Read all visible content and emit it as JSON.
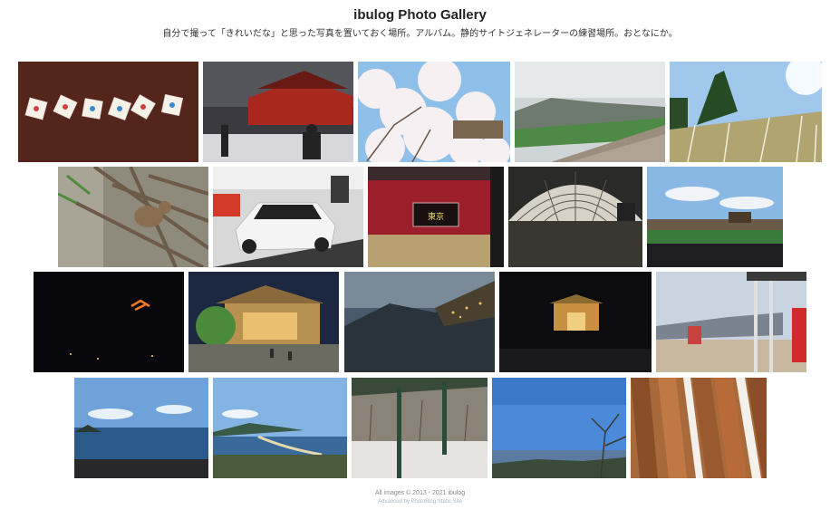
{
  "site": {
    "title": "ibulog Photo Gallery",
    "subtitle": "自分で撮って「きれいだな」と思った写真を置いておく場所。アルバム。静的サイトジェネレーターの練習場所。おとなにか。"
  },
  "photos": [
    {
      "name": "photo-dice-on-table"
    },
    {
      "name": "photo-temple-in-snow"
    },
    {
      "name": "photo-cherry-blossoms"
    },
    {
      "name": "photo-misty-valley"
    },
    {
      "name": "photo-pampas-grass-field"
    },
    {
      "name": "photo-monkey-on-branches"
    },
    {
      "name": "photo-white-sports-car"
    },
    {
      "name": "photo-red-train"
    },
    {
      "name": "photo-dome-stadium"
    },
    {
      "name": "photo-baseball-stadium"
    },
    {
      "name": "photo-night-fire-mountain"
    },
    {
      "name": "photo-chinese-temple"
    },
    {
      "name": "photo-mountain-dusk-lights"
    },
    {
      "name": "photo-night-gate"
    },
    {
      "name": "photo-beach-shop"
    },
    {
      "name": "photo-sea-coast"
    },
    {
      "name": "photo-sandbar-view"
    },
    {
      "name": "photo-snowy-pavilion"
    },
    {
      "name": "photo-bay-tree-silhouette"
    },
    {
      "name": "photo-wooden-slats"
    }
  ],
  "footer": {
    "copyright": "All images © 2013 - 2021 ibulog",
    "credit": "Advanced by PhotoBlog Static Site"
  }
}
